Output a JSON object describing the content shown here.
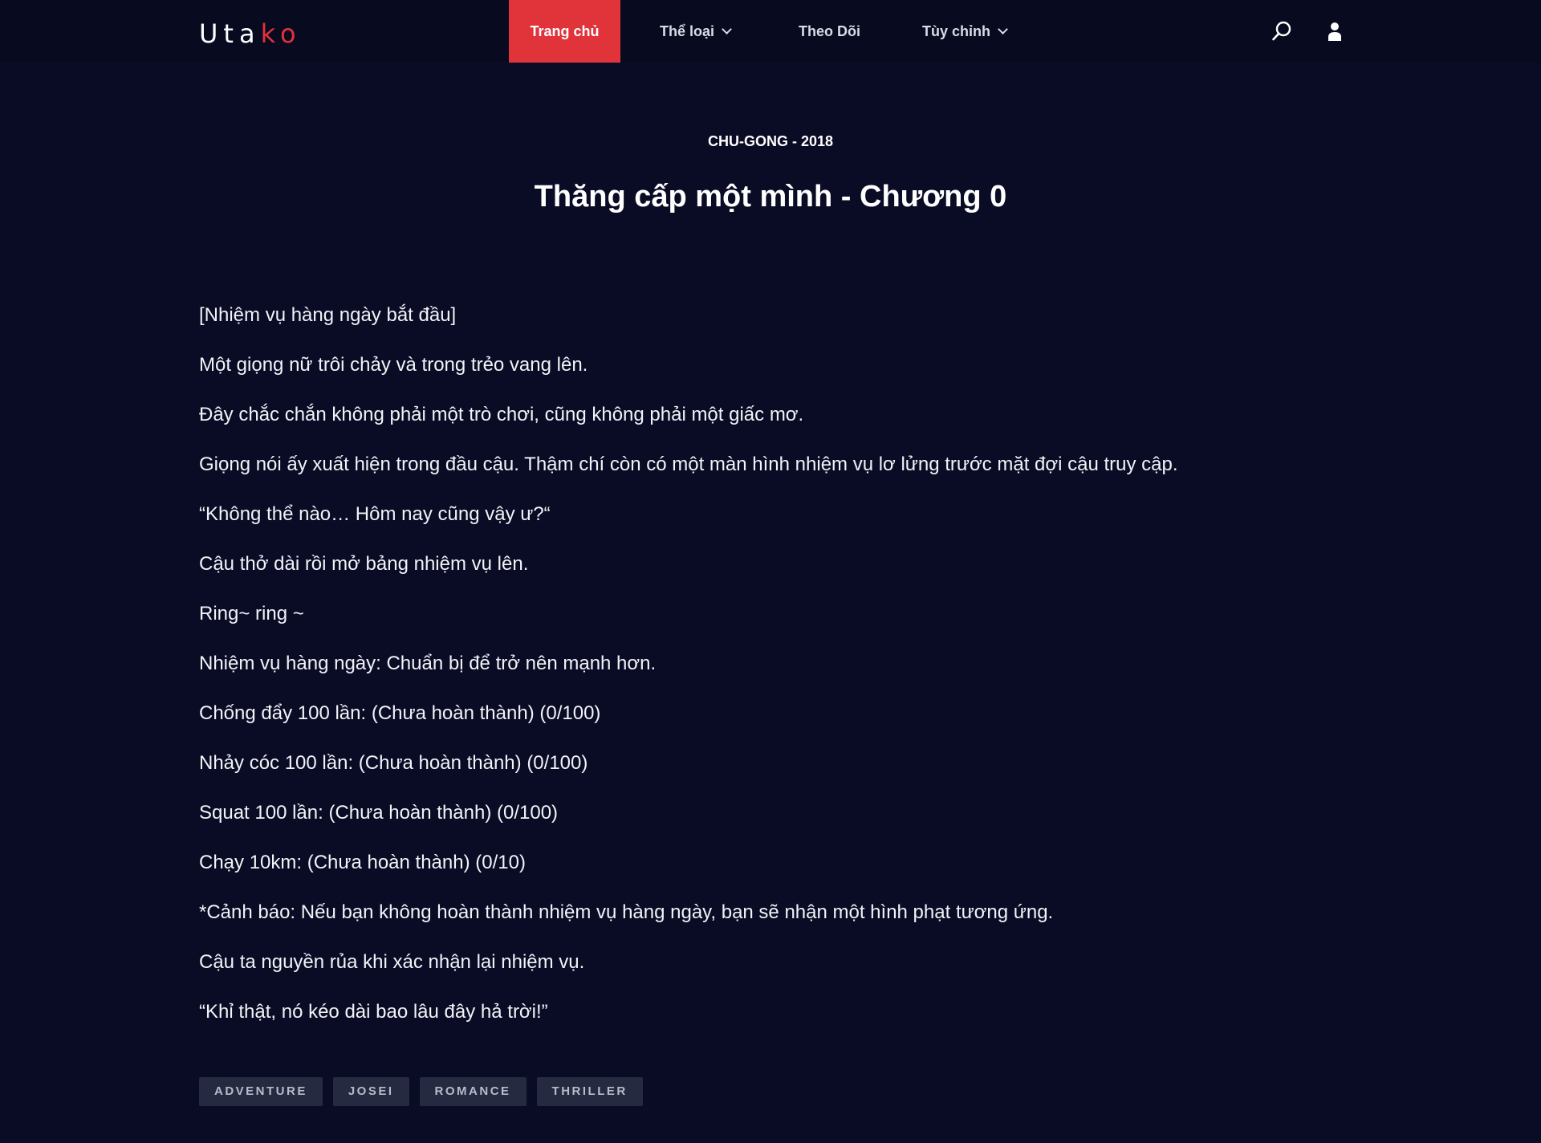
{
  "header": {
    "logo": {
      "part1": "Uta",
      "part2": "ko"
    },
    "nav": {
      "home": "Trang chủ",
      "genre": "Thể loại",
      "follow": "Theo Dõi",
      "custom": "Tùy chỉnh"
    },
    "icons": {
      "search": "search-icon",
      "user": "user-icon"
    }
  },
  "chapter": {
    "meta": "CHU-GONG - 2018",
    "title": "Thăng cấp một mình - Chương 0",
    "paragraphs": [
      "[Nhiệm vụ hàng ngày bắt đầu]",
      "Một giọng nữ trôi chảy và trong trẻo vang lên.",
      "Đây chắc chắn không phải một trò chơi, cũng không phải một giấc mơ.",
      "Giọng nói ấy xuất hiện trong đầu cậu. Thậm chí còn có một màn hình nhiệm vụ lơ lửng trước mặt đợi cậu truy cập.",
      "“Không thể nào… Hôm nay cũng vậy ư?“",
      "Cậu thở dài rồi mở bảng nhiệm vụ lên.",
      "Ring~ ring ~",
      "Nhiệm vụ hàng ngày: Chuẩn bị để trở nên mạnh hơn.",
      "Chống đẩy 100 lần: (Chưa hoàn thành) (0/100)",
      "Nhảy cóc 100 lần: (Chưa hoàn thành) (0/100)",
      "Squat 100 lần: (Chưa hoàn thành) (0/100)",
      "Chạy 10km: (Chưa hoàn thành) (0/10)",
      "*Cảnh báo: Nếu bạn không hoàn thành nhiệm vụ hàng ngày, bạn sẽ nhận một hình phạt tương ứng.",
      "Cậu ta nguyền rủa khi xác nhận lại nhiệm vụ.",
      "“Khỉ thật, nó kéo dài bao lâu đây hả trời!”"
    ],
    "tags": [
      "ADVENTURE",
      "JOSEI",
      "ROMANCE",
      "THRILLER"
    ]
  },
  "colors": {
    "background": "#0a0c26",
    "header_background": "#080a1f",
    "accent": "#e0343a",
    "tag_background": "#252a40"
  }
}
